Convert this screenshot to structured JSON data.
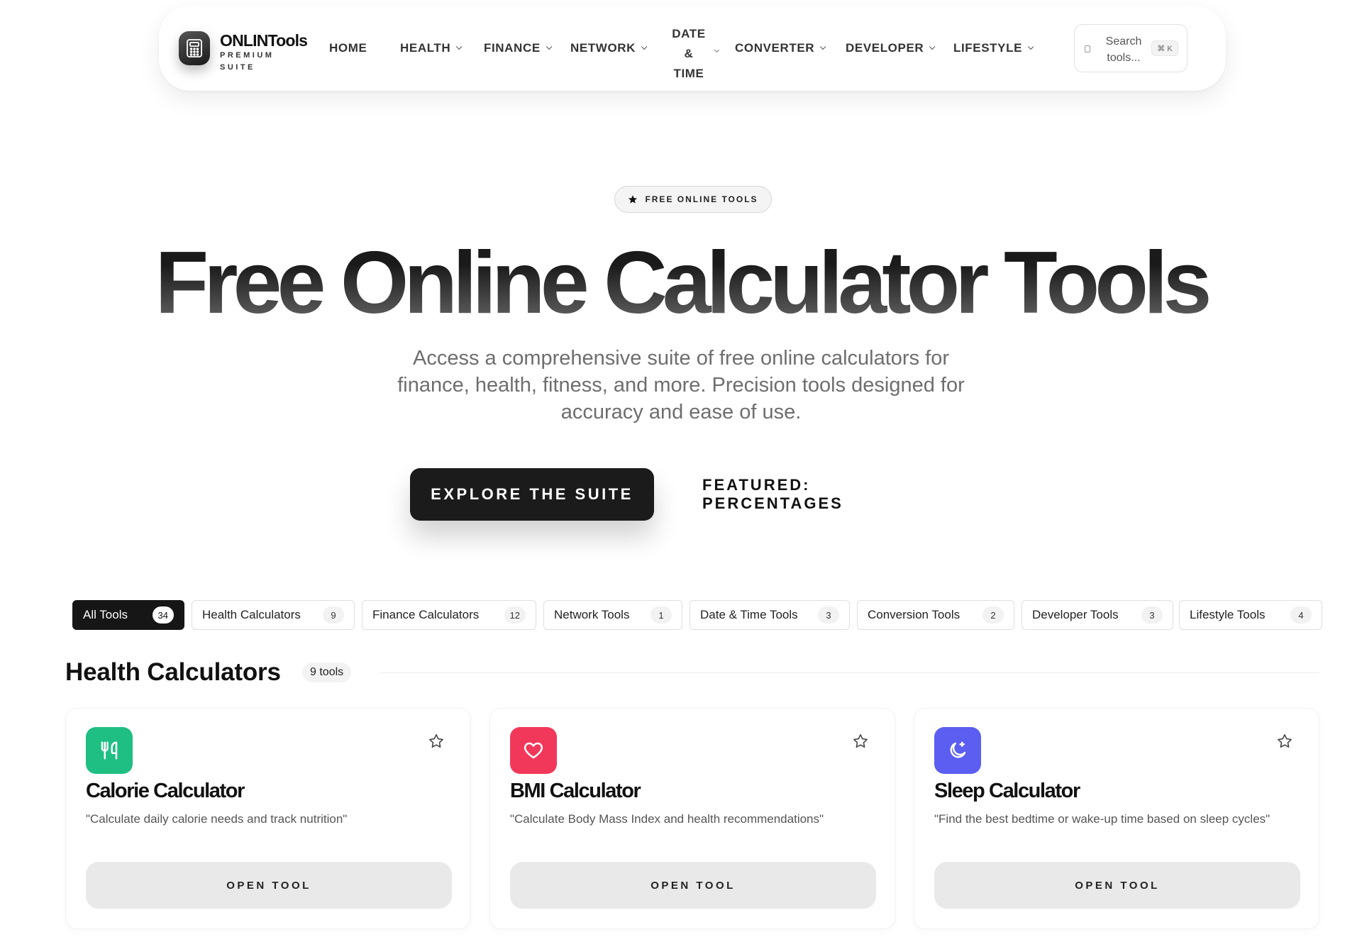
{
  "brand": {
    "name": "ONLINTools",
    "sub": "PREMIUM SUITE"
  },
  "nav": {
    "home": "HOME",
    "health": "HEALTH",
    "finance": "FINANCE",
    "network": "NETWORK",
    "date_line1": "DATE",
    "date_line2": "&",
    "date_line3": "TIME",
    "converter": "CONVERTER",
    "developer": "DEVELOPER",
    "lifestyle": "LIFESTYLE"
  },
  "search": {
    "placeholder": "Search tools...",
    "shortcut": "⌘ K"
  },
  "hero": {
    "badge": "FREE ONLINE TOOLS",
    "title": "Free Online Calculator Tools",
    "subtitle": "Access a comprehensive suite of free online calculators for finance, health, fitness, and more. Precision tools designed for accuracy and ease of use.",
    "cta_primary": "EXPLORE THE SUITE",
    "cta_secondary": "FEATURED: PERCENTAGES"
  },
  "tabs": [
    {
      "label": "All Tools",
      "count": "34"
    },
    {
      "label": "Health Calculators",
      "count": "9"
    },
    {
      "label": "Finance Calculators",
      "count": "12"
    },
    {
      "label": "Network Tools",
      "count": "1"
    },
    {
      "label": "Date & Time Tools",
      "count": "3"
    },
    {
      "label": "Conversion Tools",
      "count": "2"
    },
    {
      "label": "Developer Tools",
      "count": "3"
    },
    {
      "label": "Lifestyle Tools",
      "count": "4"
    }
  ],
  "section": {
    "title": "Health Calculators",
    "count": "9 tools"
  },
  "cards": [
    {
      "title": "Calorie Calculator",
      "desc": "\"Calculate daily calorie needs and track nutrition\"",
      "button": "OPEN TOOL",
      "icon": "utensils-icon",
      "color": "#1fbf83"
    },
    {
      "title": "BMI Calculator",
      "desc": "\"Calculate Body Mass Index and health recommendations\"",
      "button": "OPEN TOOL",
      "icon": "heart-icon",
      "color": "#f2385a"
    },
    {
      "title": "Sleep Calculator",
      "desc": "\"Find the best bedtime or wake-up time based on sleep cycles\"",
      "button": "OPEN TOOL",
      "icon": "moon-icon",
      "color": "#5b5ef0"
    }
  ]
}
